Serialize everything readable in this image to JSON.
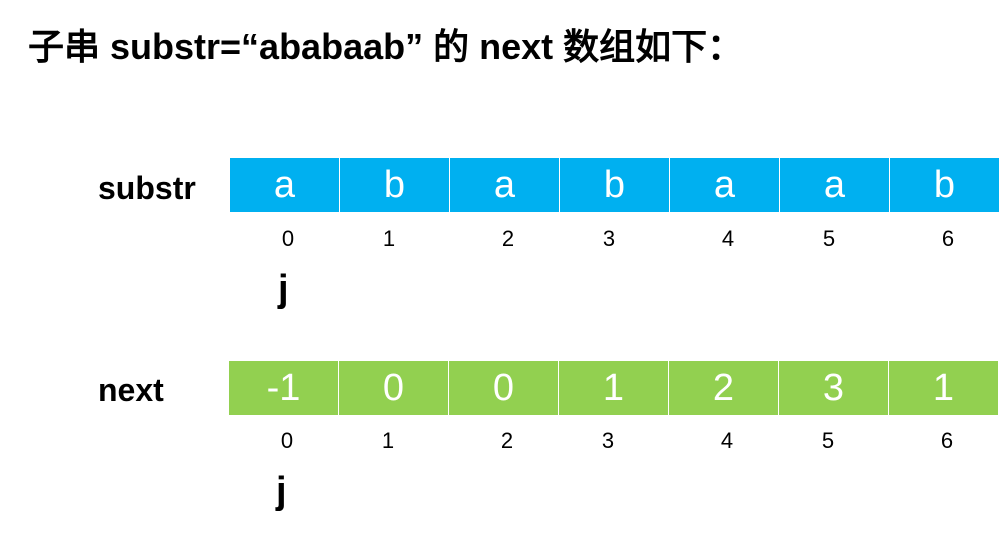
{
  "title": "子串 substr=“ababaab” 的 next 数组如下：",
  "substr": {
    "label": "substr",
    "color": "#00b0f0",
    "cells": [
      "a",
      "b",
      "a",
      "b",
      "a",
      "a",
      "b"
    ],
    "indices": [
      "0",
      "1",
      "2",
      "3",
      "4",
      "5",
      "6"
    ],
    "pointer": "j"
  },
  "next": {
    "label": "next",
    "color": "#92d050",
    "cells": [
      "-1",
      "0",
      "0",
      "1",
      "2",
      "3",
      "1"
    ],
    "indices": [
      "0",
      "1",
      "2",
      "3",
      "4",
      "5",
      "6"
    ],
    "pointer": "j"
  }
}
